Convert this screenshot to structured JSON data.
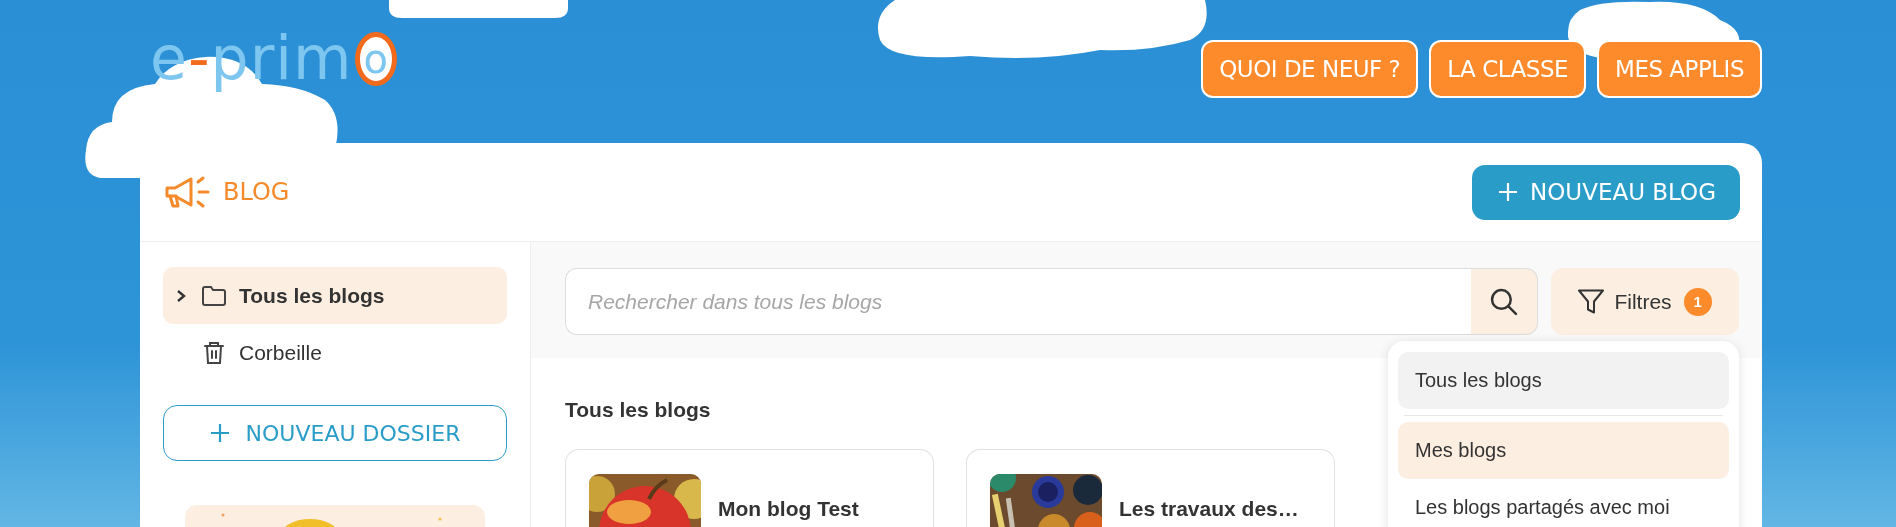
{
  "logo": "e-primo",
  "nav": [
    {
      "label": "QUOI DE NEUF ?"
    },
    {
      "label": "LA CLASSE"
    },
    {
      "label": "MES APPLIS"
    }
  ],
  "app": {
    "title": "BLOG",
    "new_button": "NOUVEAU BLOG"
  },
  "sidebar": {
    "items": [
      {
        "label": "Tous les blogs",
        "kind": "folder",
        "selected": true,
        "expanded": false
      },
      {
        "label": "Corbeille",
        "kind": "trash",
        "selected": false
      }
    ],
    "new_folder_button": "NOUVEAU DOSSIER"
  },
  "search": {
    "placeholder": "Rechercher dans tous les blogs"
  },
  "filter": {
    "label": "Filtres",
    "count": "1"
  },
  "filter_menu": [
    {
      "label": "Tous les blogs",
      "selected": false,
      "hovered": true
    },
    {
      "label": "Mes blogs",
      "selected": true,
      "hovered": false
    },
    {
      "label": "Les blogs partagés avec moi",
      "selected": false,
      "hovered": false
    }
  ],
  "section_title": "Tous les blogs",
  "blogs": [
    {
      "title": "Mon blog Test"
    },
    {
      "title": "Les travaux des…"
    }
  ]
}
